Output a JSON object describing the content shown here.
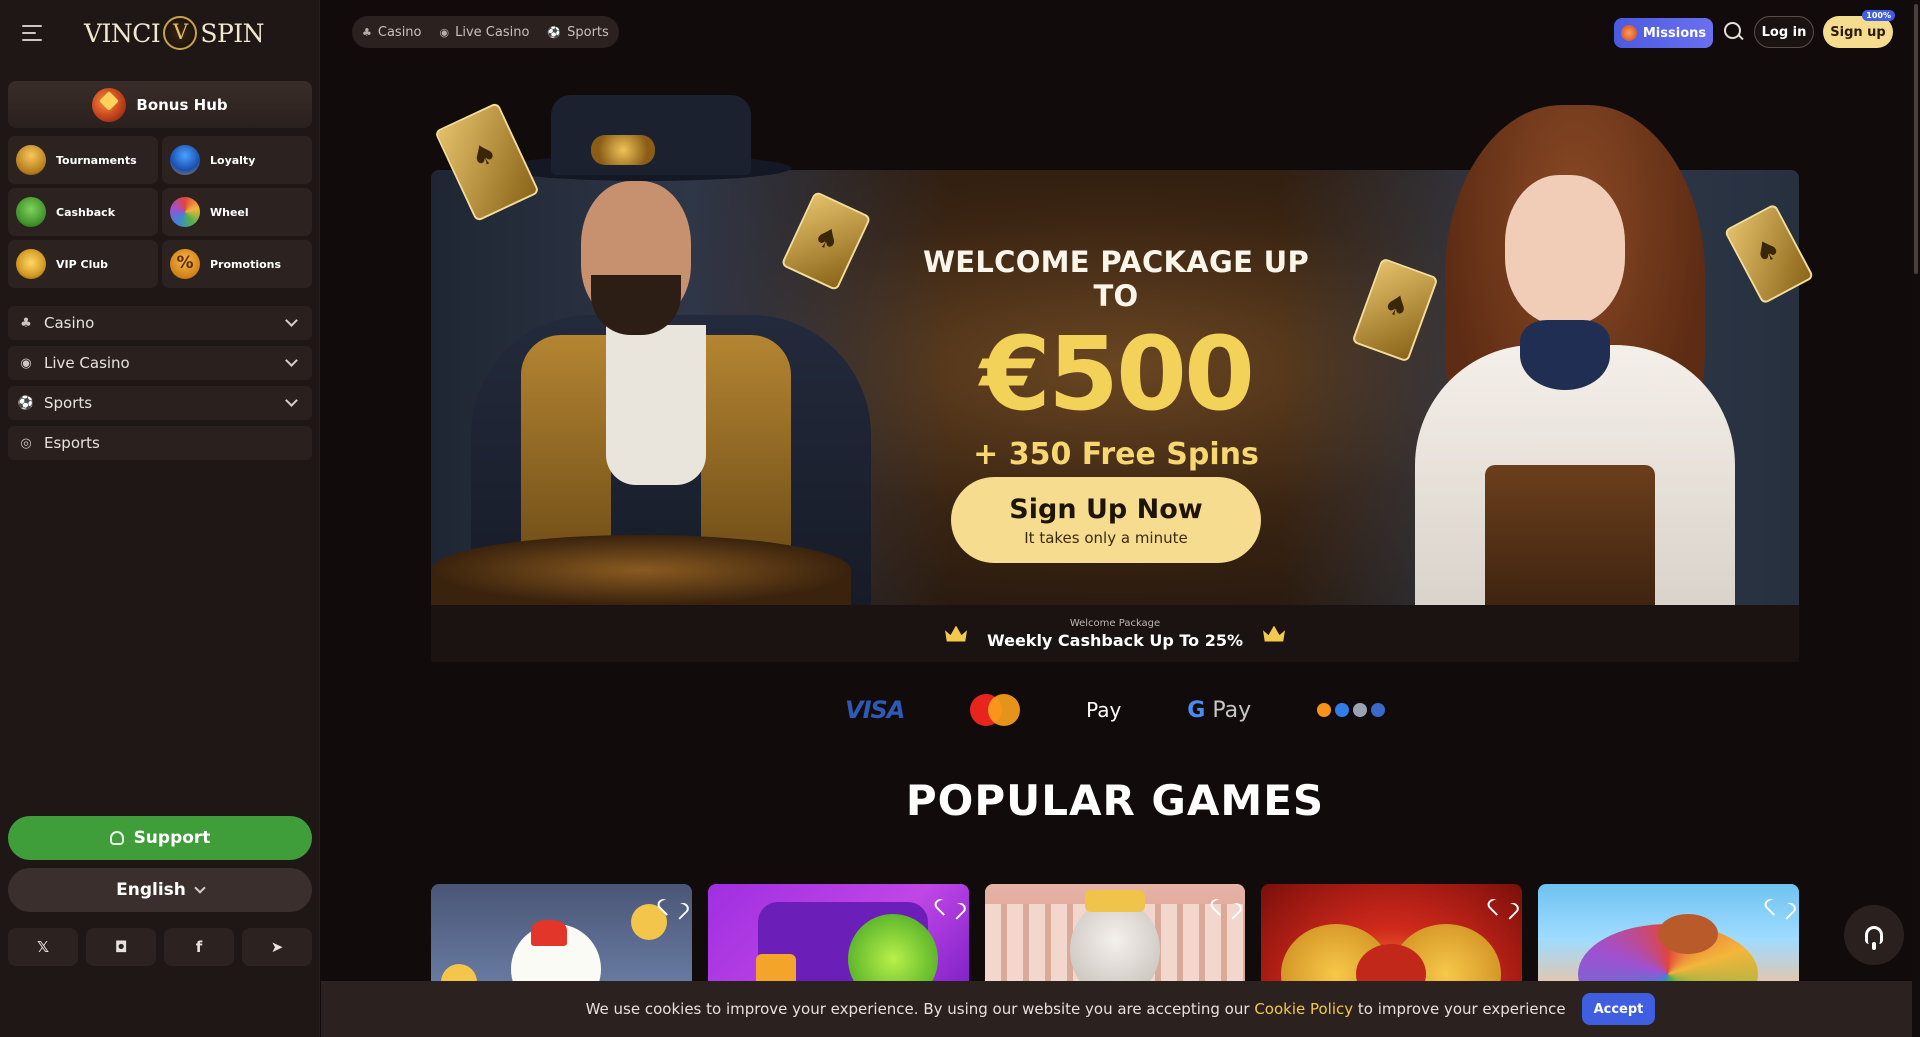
{
  "brand": {
    "logo_left": "VINCI",
    "logo_right": "SPIN"
  },
  "sidebar": {
    "bonus_hub": "Bonus Hub",
    "tiles": [
      {
        "label": "Tournaments",
        "icon": "trophy-icon"
      },
      {
        "label": "Loyalty",
        "icon": "shield-icon"
      },
      {
        "label": "Cashback",
        "icon": "cash-icon"
      },
      {
        "label": "Wheel",
        "icon": "wheel-icon"
      },
      {
        "label": "VIP Club",
        "icon": "crown-icon"
      },
      {
        "label": "Promotions",
        "icon": "percent-icon"
      }
    ],
    "nav": [
      {
        "label": "Casino",
        "icon": "cherries-icon",
        "expandable": true
      },
      {
        "label": "Live Casino",
        "icon": "broadcast-icon",
        "expandable": true
      },
      {
        "label": "Sports",
        "icon": "soccer-ball-icon",
        "expandable": true
      },
      {
        "label": "Esports",
        "icon": "gamepad-icon",
        "expandable": false
      }
    ],
    "support": "Support",
    "language": "English",
    "socials": [
      "x-icon",
      "instagram-icon",
      "facebook-icon",
      "telegram-icon"
    ]
  },
  "topbar": {
    "categories": [
      "Casino",
      "Live Casino",
      "Sports"
    ],
    "missions": "Missions",
    "login": "Log in",
    "signup": "Sign up",
    "signup_badge": "100%"
  },
  "hero": {
    "welcome": "WELCOME PACKAGE UP TO",
    "amount": "€500",
    "spins": "+ 350 Free Spins",
    "cta": "Sign Up Now",
    "cta_sub": "It takes only a minute"
  },
  "promo_strip": {
    "small": "Welcome Package",
    "big": "Weekly Cashback Up To 25%"
  },
  "payments": {
    "visa": "VISA",
    "applepay": "Pay",
    "googlepay_g": "G",
    "googlepay": "Pay"
  },
  "popular_title": "POPULAR GAMES",
  "cookie": {
    "text_before": "We use cookies to improve your experience. By using our website you are accepting our",
    "link": "Cookie Policy",
    "text_after": "to improve your experience",
    "accept": "Accept"
  },
  "colors": {
    "accent_gold": "#f6dc8e",
    "support_green": "#3f9e3a",
    "missions_blue": "#4a5be0",
    "cookie_link": "#f2c94c"
  }
}
